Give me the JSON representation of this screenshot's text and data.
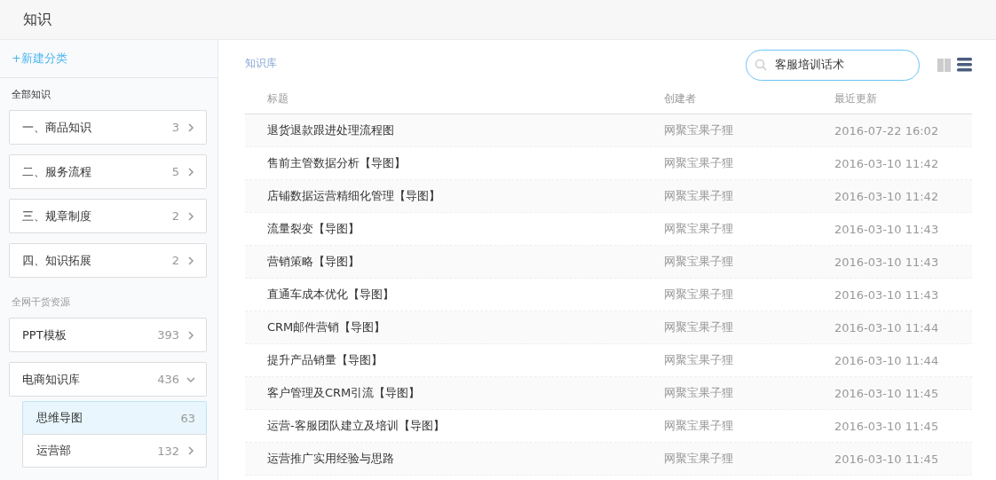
{
  "header": {
    "title": "知识"
  },
  "sidebar": {
    "new_category": "+新建分类",
    "sections": [
      {
        "label": "全部知识",
        "muted": false,
        "items": [
          {
            "label": "一、商品知识",
            "count": "3",
            "expanded": false,
            "selected": false
          },
          {
            "label": "二、服务流程",
            "count": "5",
            "expanded": false,
            "selected": false
          },
          {
            "label": "三、规章制度",
            "count": "2",
            "expanded": false,
            "selected": false
          },
          {
            "label": "四、知识拓展",
            "count": "2",
            "expanded": false,
            "selected": false
          }
        ]
      },
      {
        "label": "全网干货资源",
        "muted": true,
        "items": [
          {
            "label": "PPT模板",
            "count": "393",
            "expanded": false,
            "selected": false
          },
          {
            "label": "电商知识库",
            "count": "436",
            "expanded": true,
            "selected": false,
            "children": [
              {
                "label": "思维导图",
                "count": "63",
                "selected": true
              },
              {
                "label": "运营部",
                "count": "132",
                "selected": false
              }
            ]
          }
        ]
      }
    ]
  },
  "main": {
    "breadcrumb": "知识库",
    "search": {
      "value": "客服培训话术"
    },
    "views": [
      {
        "kind": "grid",
        "selected": false
      },
      {
        "kind": "list",
        "selected": true
      }
    ],
    "table": {
      "columns": [
        "标题",
        "创建者",
        "最近更新"
      ],
      "rows": [
        [
          "退货退款跟进处理流程图",
          "网聚宝果子狸",
          "2016-07-22 16:02"
        ],
        [
          "售前主管数据分析【导图】",
          "网聚宝果子狸",
          "2016-03-10 11:42"
        ],
        [
          "店铺数据运营精细化管理【导图】",
          "网聚宝果子狸",
          "2016-03-10 11:42"
        ],
        [
          "流量裂变【导图】",
          "网聚宝果子狸",
          "2016-03-10 11:43"
        ],
        [
          "营销策略【导图】",
          "网聚宝果子狸",
          "2016-03-10 11:43"
        ],
        [
          "直通车成本优化【导图】",
          "网聚宝果子狸",
          "2016-03-10 11:43"
        ],
        [
          "CRM邮件营销【导图】",
          "网聚宝果子狸",
          "2016-03-10 11:44"
        ],
        [
          "提升产品销量【导图】",
          "网聚宝果子狸",
          "2016-03-10 11:44"
        ],
        [
          "客户管理及CRM引流【导图】",
          "网聚宝果子狸",
          "2016-03-10 11:45"
        ],
        [
          "运营-客服团队建立及培训【导图】",
          "网聚宝果子狸",
          "2016-03-10 11:45"
        ],
        [
          "运营推广实用经验与思路",
          "网聚宝果子狸",
          "2016-03-10 11:45"
        ]
      ]
    }
  }
}
